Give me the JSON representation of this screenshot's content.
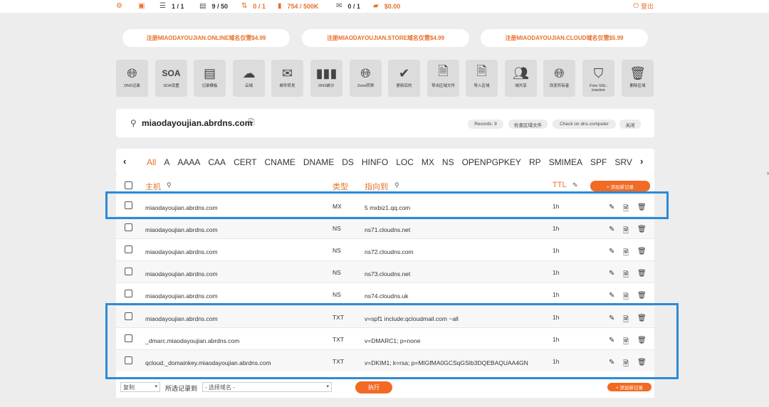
{
  "topbar": {
    "stats": [
      {
        "icon": "gear-icon",
        "glyph": "⚙",
        "value": ""
      },
      {
        "icon": "clipboard-icon",
        "glyph": "▣",
        "value": ""
      },
      {
        "icon": "zones-icon",
        "glyph": "☰",
        "value": "1 / 1"
      },
      {
        "icon": "records-icon",
        "glyph": "▤",
        "value": "9 / 50"
      },
      {
        "icon": "transfer-icon",
        "glyph": "⇅",
        "value": "0 / 1"
      },
      {
        "icon": "queries-icon",
        "glyph": "▮",
        "value": "754 / 500K"
      },
      {
        "icon": "mail-icon",
        "glyph": "✉",
        "value": "0 / 1"
      },
      {
        "icon": "wallet-icon",
        "glyph": "▰",
        "value": "$0.00"
      }
    ],
    "logout_label": "登出"
  },
  "promos": [
    "注册MIAODAYOUJIAN.ONLINE域名仅需$4.99",
    "注册MIAODAYOUJIAN.STORE域名仅需$4.99",
    "注册MIAODAYOUJIAN.CLOUD域名仅需$5.99"
  ],
  "tools": [
    {
      "name": "dns-records",
      "label": "DNS记录"
    },
    {
      "name": "soa-settings",
      "label": "SOA设置"
    },
    {
      "name": "record-templates",
      "label": "记录模板"
    },
    {
      "name": "cloud-domain",
      "label": "云域"
    },
    {
      "name": "mail-forwarding",
      "label": "邮件转发"
    },
    {
      "name": "dns-stats",
      "label": "DNS统计"
    },
    {
      "name": "zone-transfer",
      "label": "Zone转移"
    },
    {
      "name": "updated",
      "label": "更新后的"
    },
    {
      "name": "export-zone",
      "label": "导出区域文件"
    },
    {
      "name": "import-zone",
      "label": "导入区域"
    },
    {
      "name": "domain-share",
      "label": "域共享"
    },
    {
      "name": "change-owner",
      "label": "改变所有者"
    },
    {
      "name": "free-ssl",
      "label": "Free SSL: inactive"
    },
    {
      "name": "delete-zone",
      "label": "删除区域"
    }
  ],
  "domain": {
    "name": "miaodayoujian.abrdns.com",
    "buttons": [
      "Records: 9",
      "检查区域文件",
      "Check on dns.computer",
      "关闭"
    ]
  },
  "types": [
    "All",
    "A",
    "AAAA",
    "CAA",
    "CERT",
    "CNAME",
    "DNAME",
    "DS",
    "HINFO",
    "LOC",
    "MX",
    "NS",
    "OPENPGPKEY",
    "RP",
    "SMIMEA",
    "SPF",
    "SRV"
  ],
  "table": {
    "headers": {
      "host": "主机",
      "type": "类型",
      "points_to": "指向到",
      "ttl": "TTL"
    },
    "add_label": "+ 添加新记录",
    "rows": [
      {
        "host": "miaodayoujian.abrdns.com",
        "type": "MX",
        "value": "5 mxbiz1.qq.com",
        "ttl": "1h"
      },
      {
        "host": "miaodayoujian.abrdns.com",
        "type": "NS",
        "value": "ns71.cloudns.net",
        "ttl": "1h"
      },
      {
        "host": "miaodayoujian.abrdns.com",
        "type": "NS",
        "value": "ns72.cloudns.com",
        "ttl": "1h"
      },
      {
        "host": "miaodayoujian.abrdns.com",
        "type": "NS",
        "value": "ns73.cloudns.net",
        "ttl": "1h"
      },
      {
        "host": "miaodayoujian.abrdns.com",
        "type": "NS",
        "value": "ns74.cloudns.uk",
        "ttl": "1h"
      },
      {
        "host": "miaodayoujian.abrdns.com",
        "type": "TXT",
        "value": "v=spf1 include:qcloudmail.com ~all",
        "ttl": "1h"
      },
      {
        "host": "_dmarc.miaodayoujian.abrdns.com",
        "type": "TXT",
        "value": "v=DMARC1; p=none",
        "ttl": "1h"
      },
      {
        "host": "qcloud._domainkey.miaodayoujian.abrdns.com",
        "type": "TXT",
        "value": "v=DKIM1; k=rsa; p=MIGfMA0GCSqGSIb3DQEBAQUAA4GN",
        "ttl": "1h"
      }
    ]
  },
  "bottom": {
    "copy_select": "复制",
    "selected_label": "所选记录到",
    "domain_select": "- 选择域名 -",
    "execute_label": "执行",
    "add_label": "+ 添加新记录"
  },
  "colors": {
    "accent": "#f26a23",
    "highlight": "#2a8bd8"
  }
}
